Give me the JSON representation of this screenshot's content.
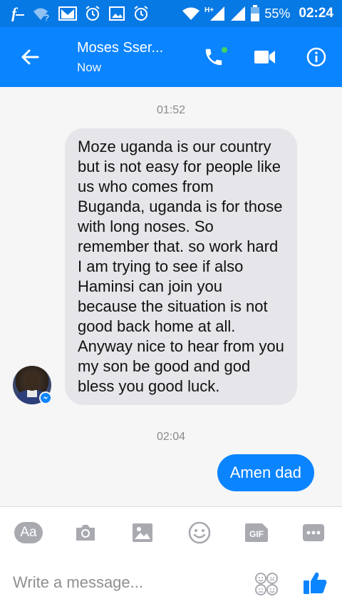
{
  "status_bar": {
    "battery": "55%",
    "time": "02:24",
    "network": "H+"
  },
  "header": {
    "contact_name": "Moses Sser...",
    "presence": "Now"
  },
  "conversation": {
    "messages": [
      {
        "timestamp": "01:52",
        "direction": "incoming",
        "text": "Moze uganda is our country but is not easy for people like us who comes from Buganda, uganda is for those with long noses. So remember that. so work hard  I am trying to see if also Haminsi can join you because the situation is not good back home at all. Anyway nice to hear from you my son be good and god bless you good luck."
      },
      {
        "timestamp": "02:04",
        "direction": "outgoing",
        "text": "Amen dad"
      }
    ]
  },
  "composer": {
    "aa_label": "Aa",
    "gif_label": "GIF",
    "placeholder": "Write a message..."
  },
  "colors": {
    "status_bar": "#0779e4",
    "header": "#0b84ff",
    "outgoing_bubble": "#0b84ff",
    "incoming_bubble": "#e5e5ea",
    "toolbar_icon": "#a9aab0",
    "online_dot": "#44d163"
  },
  "icons": [
    "facebook-icon",
    "wifi-question-icon",
    "gmail-icon",
    "alarm-icon",
    "image-icon",
    "alarm-icon",
    "wifi-icon",
    "signal-icon",
    "battery-icon",
    "back-arrow-icon",
    "phone-icon",
    "video-icon",
    "info-icon",
    "camera-icon",
    "gallery-icon",
    "emoji-icon",
    "more-icon",
    "sticker-icon",
    "thumbs-up-icon",
    "messenger-badge-icon"
  ]
}
